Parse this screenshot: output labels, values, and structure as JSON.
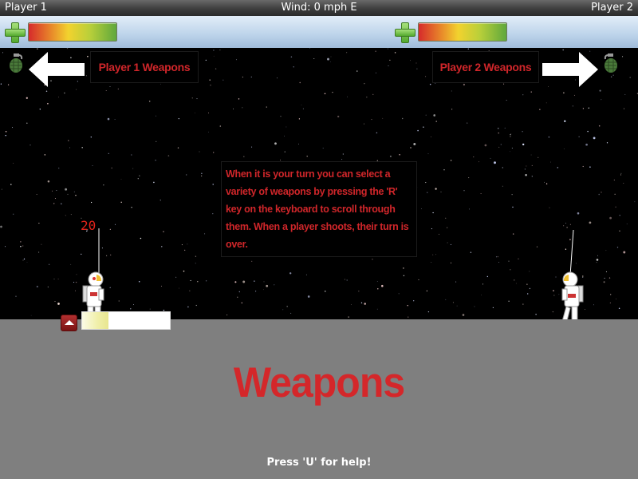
{
  "topbar": {
    "player1": "Player 1",
    "wind": "Wind: 0 mph E",
    "player2": "Player 2"
  },
  "players": {
    "player1": {
      "health_fraction": 1.0
    },
    "player2": {
      "health_fraction": 1.0
    }
  },
  "weapons": {
    "player1_label": "Player 1 Weapons",
    "player2_label": "Player 2 Weapons",
    "player1_icon": "grenade-icon",
    "player2_icon": "grenade-icon"
  },
  "help_box": {
    "text": "When it is your turn you can select a variety of weapons by pressing the 'R' key on the keyboard to scroll through them. When a player shoots, their turn is over."
  },
  "shot": {
    "power_value": "20",
    "power_fraction": 0.3
  },
  "ground": {
    "title": "Weapons",
    "help_hint": "Press 'U' for help!"
  },
  "colors": {
    "accent_red": "#d0262a",
    "ground_gray": "#7f7f7f",
    "sky": "#000000"
  }
}
